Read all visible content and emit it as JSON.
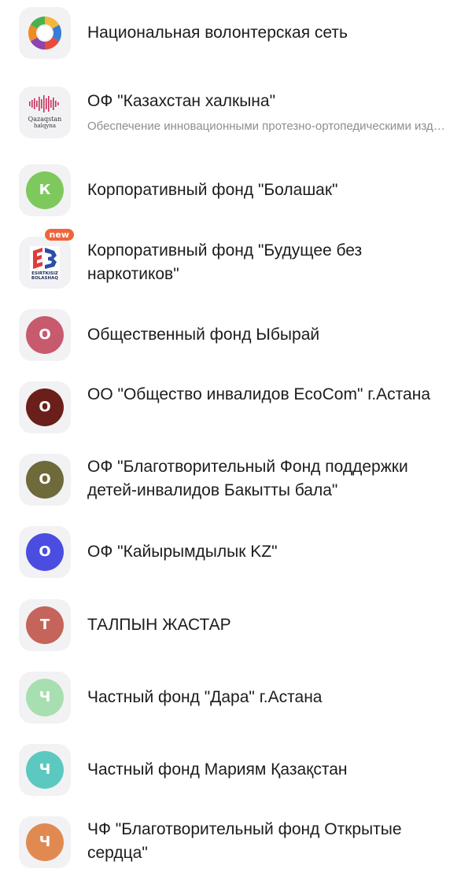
{
  "organizations": [
    {
      "title": "Национальная волонтерская сеть",
      "logo": "volunteer-network-logo"
    },
    {
      "title": "ОФ \"Казахстан халкына\"",
      "subtitle": "Обеспечение инновационными протезно-ортопедическими изделиями",
      "logo": "qazaqstan-halqyna-logo",
      "logo_text_1": "Qazaqstan",
      "logo_text_2": "halqyna"
    },
    {
      "title": "Корпоративный фонд \"Болашак\"",
      "letter": "К",
      "color": "#7dc95e"
    },
    {
      "title": "Корпоративный фонд \"Будущее без наркотиков\"",
      "badge": "new",
      "logo": "esirtkisiz-bolashaq-logo",
      "logo_text_1": "ESIRTKISIZ",
      "logo_text_2": "BOLASHAQ"
    },
    {
      "title": "Общественный фонд Ыбырай",
      "letter": "О",
      "color": "#c85a6e"
    },
    {
      "title": "ОО \"Общество инвалидов EcoCom\" г.Астана",
      "letter": "О",
      "color": "#6b1f1a"
    },
    {
      "title": "ОФ \"Благотворительный Фонд поддержки детей-инвалидов Бакытты бала\"",
      "letter": "О",
      "color": "#6e6a3a"
    },
    {
      "title": "ОФ \"Кайырымдылык KZ\"",
      "letter": "О",
      "color": "#4b4de0"
    },
    {
      "title": "ТАЛПЫН ЖАСТАР",
      "letter": "Т",
      "color": "#c4645a"
    },
    {
      "title": "Частный фонд \"Дара\" г.Астана",
      "letter": "Ч",
      "color": "#a8dfb0"
    },
    {
      "title": "Частный фонд Мариям Қазақстан",
      "letter": "Ч",
      "color": "#5cc9c0"
    },
    {
      "title": "ЧФ \"Благотворительный фонд Открытые сердца\"",
      "letter": "Ч",
      "color": "#e08a52"
    }
  ]
}
